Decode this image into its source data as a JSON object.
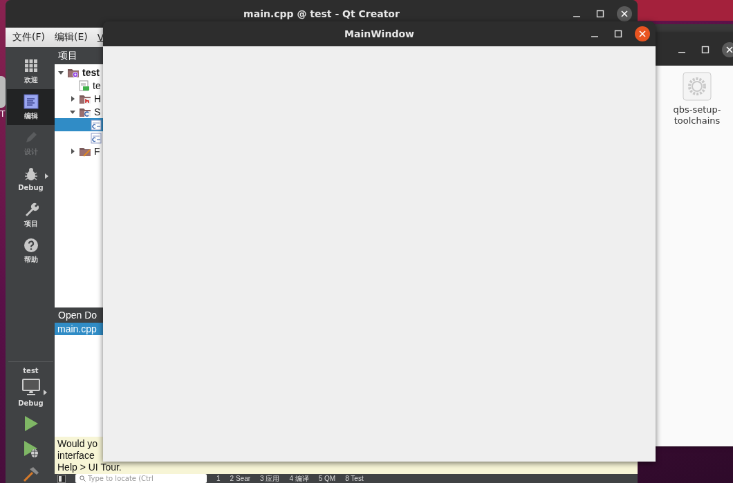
{
  "dock": {
    "label": "T"
  },
  "creator_window": {
    "title": "main.cpp @ test - Qt Creator",
    "menu": [
      "文件(F)",
      "编辑(E)",
      "V"
    ],
    "modes": [
      {
        "label": "欢迎",
        "kind": "welcome",
        "selected": false,
        "disabled": false
      },
      {
        "label": "编辑",
        "kind": "edit",
        "selected": true,
        "disabled": false
      },
      {
        "label": "设计",
        "kind": "design",
        "selected": false,
        "disabled": true
      },
      {
        "label": "Debug",
        "kind": "debug",
        "selected": false,
        "disabled": false
      },
      {
        "label": "项目",
        "kind": "projects",
        "selected": false,
        "disabled": false
      },
      {
        "label": "帮助",
        "kind": "help",
        "selected": false,
        "disabled": false
      }
    ],
    "kit": {
      "project": "test",
      "build": "Debug"
    },
    "actions": [
      {
        "kind": "run"
      },
      {
        "kind": "debug-run"
      },
      {
        "kind": "build"
      }
    ],
    "project_pane": {
      "title": "项目",
      "tree": [
        {
          "label": "test",
          "kind": "project",
          "expanded": true,
          "selected": false,
          "children": [
            {
              "label": "te",
              "kind": "pro-file",
              "selected": false
            },
            {
              "label": "H",
              "kind": "headers",
              "expanded": false,
              "selected": false
            },
            {
              "label": "S",
              "kind": "sources",
              "expanded": true,
              "selected": false,
              "children": [
                {
                  "kind": "cpp",
                  "selected": true
                },
                {
                  "kind": "cpp",
                  "selected": false
                }
              ]
            },
            {
              "label": "F",
              "kind": "forms",
              "expanded": false,
              "selected": false
            }
          ]
        }
      ]
    },
    "open_documents": {
      "title": "Open Do",
      "items": [
        {
          "label": "main.cpp",
          "selected": true
        }
      ]
    },
    "notice": {
      "lines": [
        "Would yo",
        "interface",
        "Help > UI Tour."
      ]
    },
    "locator": {
      "placeholder": "Type to locate (Ctrl"
    },
    "output_panes": [
      "1",
      "2 Sear",
      "3 应用",
      "4 编译",
      "5 QM",
      "8 Test"
    ]
  },
  "file_window": {
    "items": [
      {
        "label": "qbs-setup-toolchains"
      }
    ]
  },
  "main_window": {
    "title": "MainWindow"
  }
}
